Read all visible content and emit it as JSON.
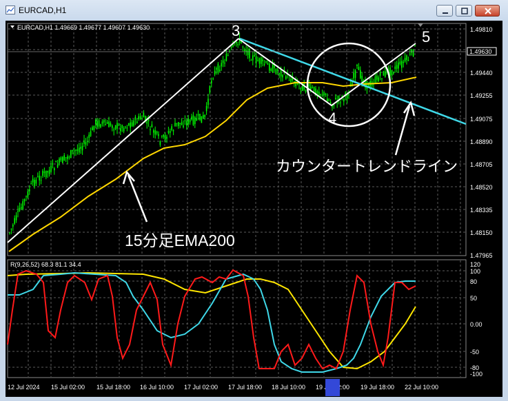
{
  "window": {
    "title": "EURCAD,H1"
  },
  "price_panel": {
    "header": "EURCAD,H1  1.49669 1.49677 1.49607 1.49630",
    "current_price": "1.49630",
    "price_scale": [
      "1.49810",
      "1.49440",
      "1.49255",
      "1.49075",
      "1.48890",
      "1.48705",
      "1.48520",
      "1.48335",
      "1.48150",
      "1.47965"
    ]
  },
  "annotations": {
    "wave_3": "3",
    "wave_4": "4",
    "wave_5": "5",
    "countertrend_label": "カウンタートレンドライン",
    "ema_label": "15分足EMA200"
  },
  "indicator_panel": {
    "header": "R(9,26,52) 68.3 81.1 34.4",
    "scale": [
      "120",
      "100",
      "80",
      "50",
      "0.00",
      "-50",
      "-80",
      "-100"
    ]
  },
  "time_axis": {
    "labels": [
      "12 Jul 2024",
      "15 Jul 02:00",
      "15 Jul 18:00",
      "16 Jul 10:00",
      "17 Jul 02:00",
      "17 Jul 18:00",
      "18 Jul 10:00",
      "19 Jul 02:00",
      "19 Jul 18:00",
      "22 Jul 10:00"
    ]
  },
  "colors": {
    "background": "#000000",
    "candle": "#00ff00",
    "ema": "#ffd700",
    "trendline": "#ffffff",
    "countertrend": "#3fd8e8",
    "osc_red": "#ff1a1a",
    "osc_cyan": "#3fd8e8",
    "osc_yellow": "#ffe600",
    "marker": "#3348d8"
  }
}
